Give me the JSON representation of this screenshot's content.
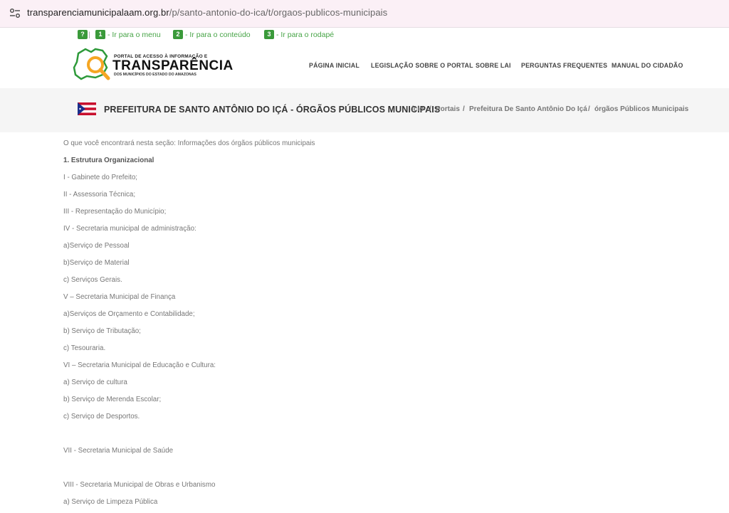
{
  "browser": {
    "url_host": "transparenciamunicipalaam.org.br",
    "url_path": "/p/santo-antonio-do-ica/t/orgaos-publicos-municipais",
    "site_info_icon": "tune-icon"
  },
  "accessibility": {
    "help_key": "?",
    "separator": "|",
    "links": [
      {
        "key": "1",
        "label": "- Ir para o menu"
      },
      {
        "key": "2",
        "label": "- Ir para o conteúdo"
      },
      {
        "key": "3",
        "label": "- Ir para o rodapé"
      }
    ]
  },
  "logo": {
    "line1": "PORTAL DE ACESSO À INFORMAÇÃO E",
    "line2": "TRANSPARÊNCIA",
    "line3": "DOS MUNICÍPIOS DO ESTADO DO AMAZONAS"
  },
  "nav": {
    "items": [
      "PÁGINA INICIAL",
      "LEGISLAÇÃO SOBRE O PORTAL",
      "SOBRE LAI",
      "PERGUNTAS FREQUENTES",
      "MANUAL DO CIDADÃO"
    ]
  },
  "title_band": {
    "title": "PREFEITURA DE SANTO ANTÔNIO DO IÇÁ - ÓRGÃOS PÚBLICOS MUNICIPAIS",
    "breadcrumb": [
      "ício",
      "Portais",
      "Prefeitura De Santo Antônio Do Içá",
      "órgãos Públicos Municipais"
    ],
    "breadcrumb_sep": "/",
    "flag_colors": {
      "blue": "#1a2f8c",
      "red": "#c8102e",
      "white": "#ffffff"
    }
  },
  "content": {
    "lines": [
      "O que você encontrará nesta seção: Informações dos órgãos públicos municipais",
      "1. Estrutura Organizacional",
      "I - Gabinete do Prefeito;",
      "II - Assessoria Técnica;",
      "III - Representação do Município;",
      "IV - Secretaria municipal de administração:",
      "a)Serviço de Pessoal",
      "b)Serviço de Material",
      "c) Serviços Gerais.",
      "V – Secretaria Municipal de Finança",
      "a)Serviços de Orçamento e Contabilidade;",
      "b) Serviço de Tributação;",
      "c) Tesouraria.",
      "VI – Secretaria Municipal de Educação e Cultura:",
      "a) Serviço de cultura",
      "b) Serviço de Merenda  Escolar;",
      "c) Serviço de Desportos.",
      "VII - Secretaria Municipal de Saúde",
      "VIII - Secretaria Municipal de Obras e Urbanismo",
      "a) Serviço de Limpeza Pública"
    ]
  },
  "colors": {
    "accent_green": "#3a9a3a",
    "band_bg": "#f5f5f5",
    "logo_orange": "#f5a623"
  }
}
